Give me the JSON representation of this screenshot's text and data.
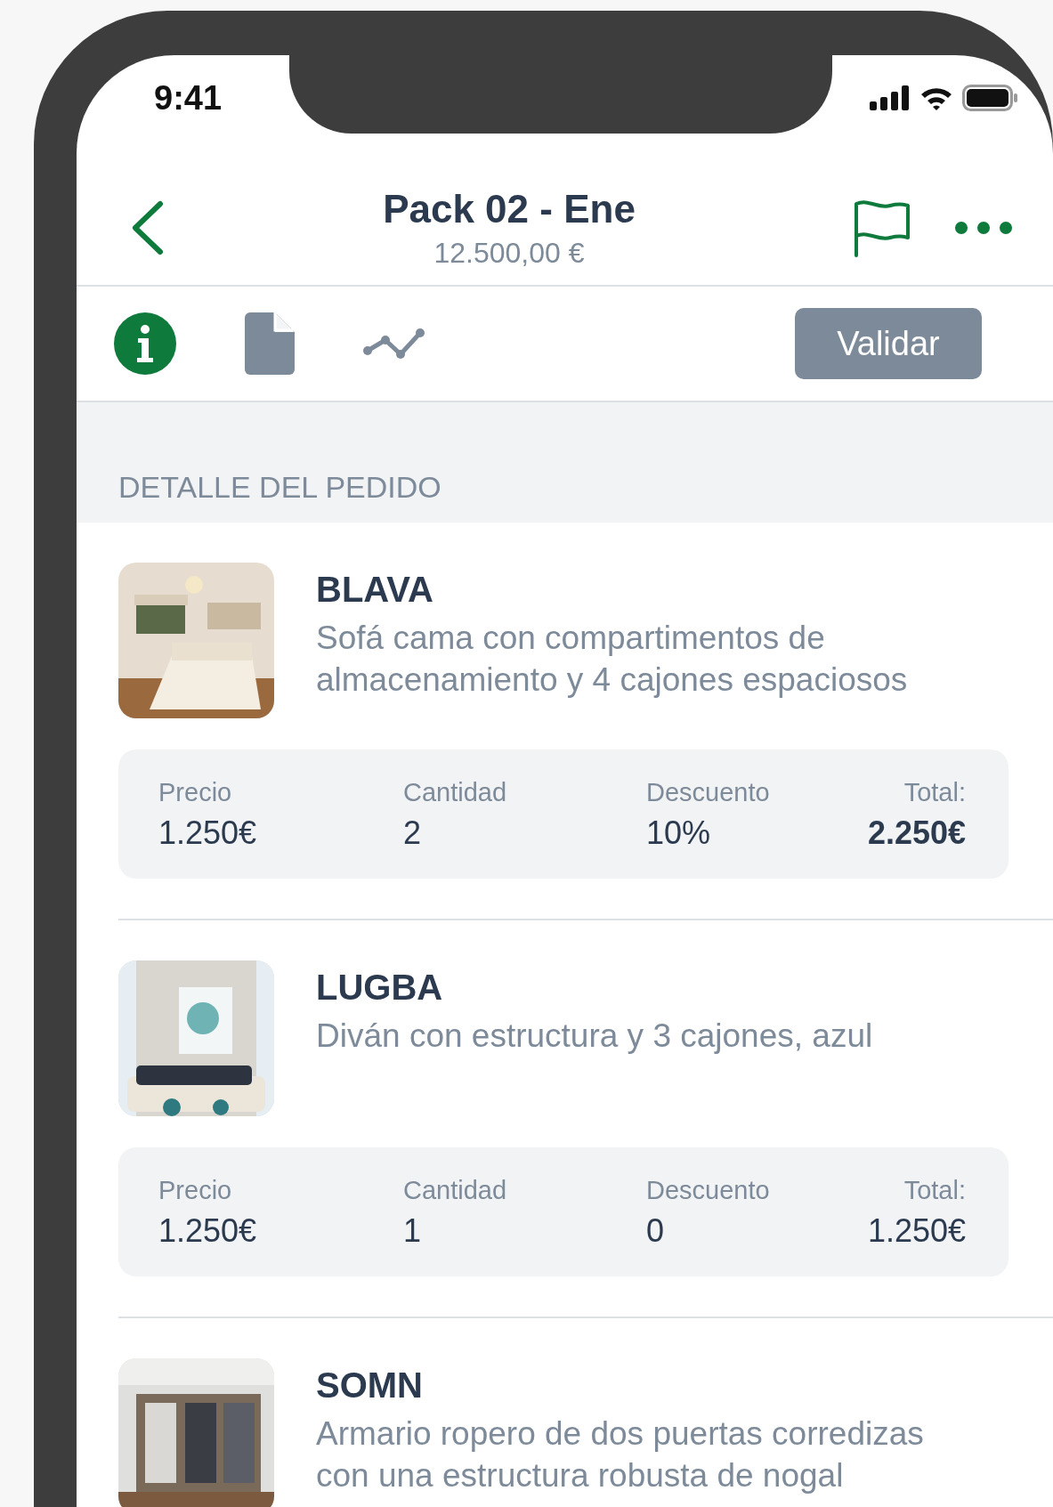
{
  "status_bar": {
    "time": "9:41"
  },
  "header": {
    "title": "Pack 02 - Ene",
    "subtitle": "12.500,00 €"
  },
  "toolbar": {
    "tabs": [
      {
        "kind": "info",
        "selected": true
      },
      {
        "kind": "document",
        "selected": false
      },
      {
        "kind": "chart",
        "selected": false
      }
    ],
    "button": "Validar"
  },
  "section_title": "DETALLE DEL PEDIDO",
  "items": [
    {
      "name": "BLAVA",
      "description": "Sofá cama con compartimentos de almacenamiento y 4 cajones espaciosos",
      "stats": [
        {
          "label": "Precio",
          "value": "1.250€"
        },
        {
          "label": "Cantidad",
          "value": "2"
        },
        {
          "label": "Descuento",
          "value": "10%"
        },
        {
          "label": "Total:",
          "value": "2.250€"
        }
      ],
      "total_bold": true
    },
    {
      "name": "LUGBA",
      "description": "Diván con estructura y 3 cajones, azul",
      "stats": [
        {
          "label": "Precio",
          "value": "1.250€"
        },
        {
          "label": "Cantidad",
          "value": "1"
        },
        {
          "label": "Descuento",
          "value": "0"
        },
        {
          "label": "Total:",
          "value": "1.250€"
        }
      ],
      "total_bold": false
    },
    {
      "name": "SOMN",
      "description": "Armario ropero de dos puertas corredizas con una estructura robusta de nogal"
    }
  ]
}
